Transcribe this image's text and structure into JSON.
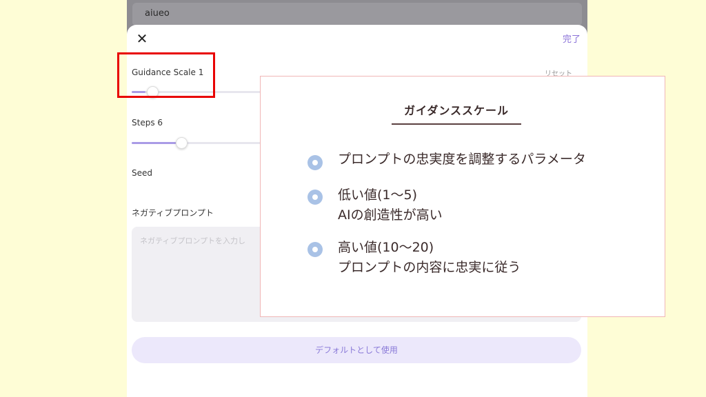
{
  "app": {
    "prompt_value": "aiueo",
    "done_label": "完了",
    "reset_label": "リセット",
    "guidance_label": "Guidance Scale 1",
    "guidance_value": 1,
    "steps_label": "Steps 6",
    "steps_value": 6,
    "seed_label": "Seed",
    "negative_label": "ネガティブプロンプト",
    "negative_placeholder": "ネガティブプロンプトを入力し",
    "default_button": "デフォルトとして使用",
    "close_icon": "close-icon"
  },
  "callout": {
    "title": "ガイダンススケール",
    "items": [
      {
        "line1": "プロンプトの忠実度を調整するパラメータ",
        "line2": ""
      },
      {
        "line1": "低い値(1〜5)",
        "line2": "AIの創造性が高い"
      },
      {
        "line1": "高い値(10〜20)",
        "line2": "プロンプトの内容に忠実に従う"
      }
    ]
  },
  "colors": {
    "background": "#fefdd6",
    "accent": "#8a72d8",
    "highlight": "#e80000",
    "bullet": "#a9c2e6"
  }
}
